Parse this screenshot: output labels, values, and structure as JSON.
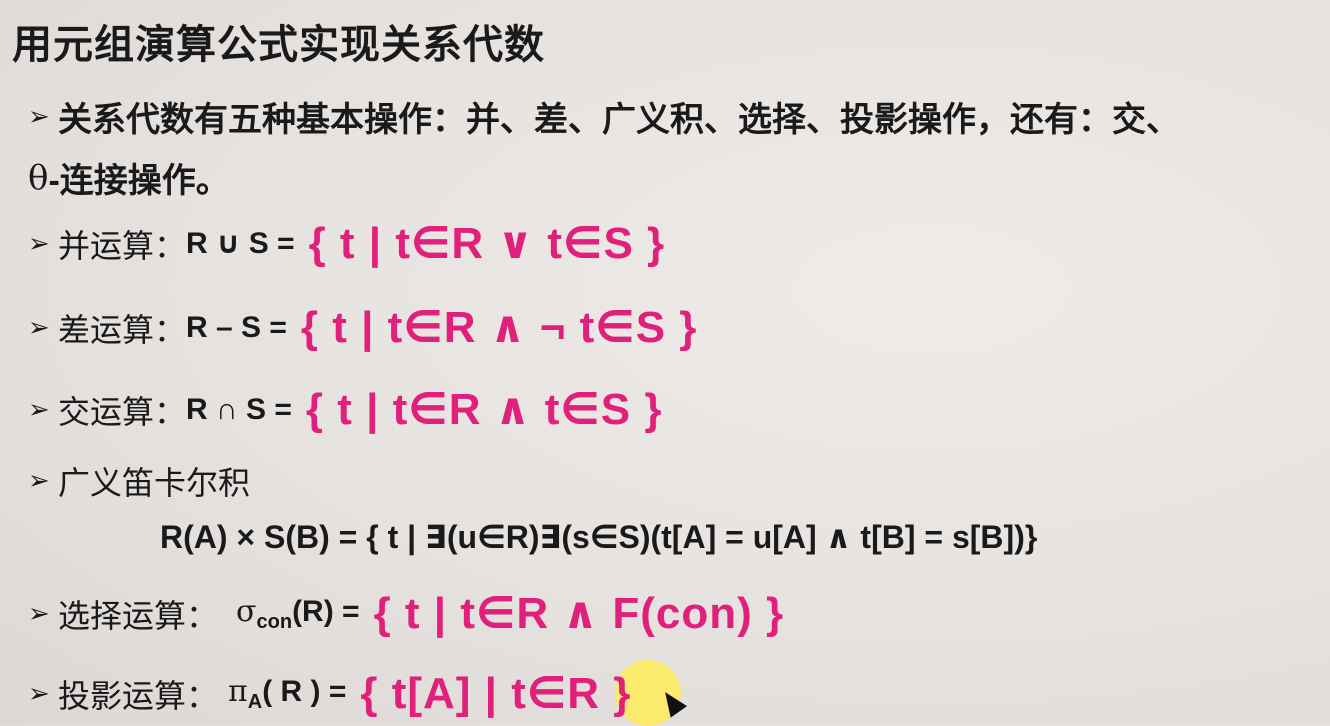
{
  "title": "用元组演算公式实现关系代数",
  "intro": {
    "line1": "关系代数有五种基本操作：并、差、广义积、选择、投影操作，还有：交、",
    "theta": "θ",
    "line2_rest": "-连接操作。"
  },
  "arrow_glyph": "➢",
  "ops": {
    "union": {
      "label": "并运算：",
      "lhs": "R ∪ S =",
      "rhs": "{ t | t∈R ∨ t∈S }"
    },
    "difference": {
      "label": "差运算：",
      "lhs": "R – S =",
      "rhs": "{ t | t∈R ∧ ¬ t∈S }"
    },
    "intersection": {
      "label": "交运算：",
      "lhs": "R ∩ S =",
      "rhs": "{ t | t∈R ∧ t∈S }"
    },
    "cartesian": {
      "label": "广义笛卡尔积",
      "formula": "R(A) × S(B) = { t | ∃(u∈R)∃(s∈S)(t[A] = u[A] ∧ t[B] = s[B])}"
    },
    "selection": {
      "label": "选择运算：",
      "sigma": "σ",
      "sub": "con",
      "lhs_rest": "(R) =",
      "rhs": "{ t | t∈R ∧  F(con) }"
    },
    "projection": {
      "label": "投影运算：",
      "pi": "π",
      "sub": "A",
      "lhs_rest": "( R ) =",
      "rhs": "{ t[A] | t∈R }"
    }
  },
  "colors": {
    "formula": "#e0207a",
    "highlight": "#ffec5a"
  }
}
